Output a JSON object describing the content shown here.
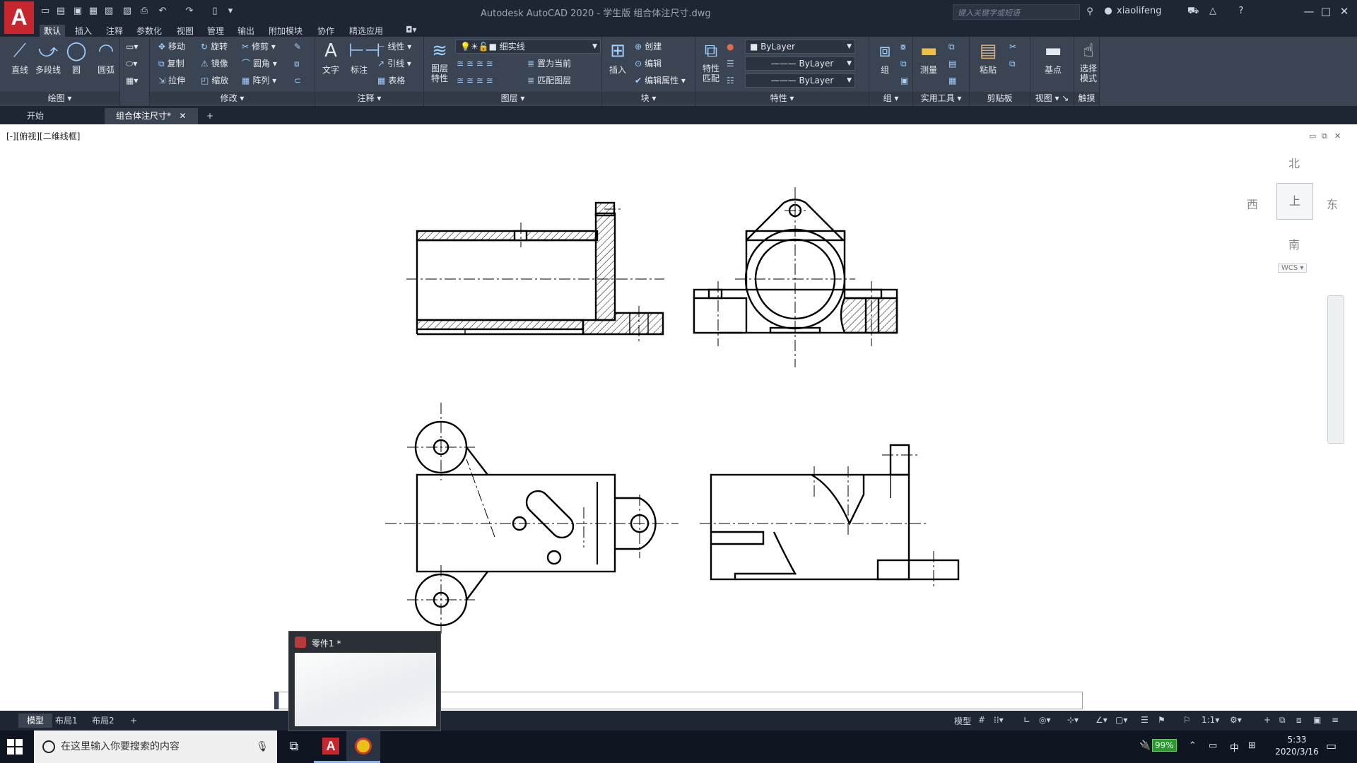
{
  "app": {
    "title": "Autodesk AutoCAD 2020 - 学生版    组合体注尺寸.dwg",
    "search_placeholder": "键入关键字或短语",
    "user": "xiaolifeng"
  },
  "menu": [
    "默认",
    "插入",
    "注释",
    "参数化",
    "视图",
    "管理",
    "输出",
    "附加模块",
    "协作",
    "精选应用"
  ],
  "ribbon": {
    "draw": {
      "title": "绘图",
      "line": "直线",
      "polyline": "多段线",
      "circle": "圆",
      "arc": "圆弧"
    },
    "modify": {
      "title": "修改",
      "move": "移动",
      "rotate": "旋转",
      "trim": "修剪",
      "copy": "复制",
      "mirror": "镜像",
      "fillet": "圆角",
      "stretch": "拉伸",
      "scale": "缩放",
      "array": "阵列"
    },
    "annotation": {
      "title": "注释",
      "text": "文字",
      "dimension": "标注",
      "linear": "线性",
      "leader": "引线",
      "table": "表格"
    },
    "layers": {
      "title": "图层",
      "props": "图层\n特性",
      "layer": "细实线",
      "set_current": "置为当前",
      "match_layer": "匹配图层"
    },
    "block": {
      "title": "块",
      "insert": "插入",
      "create": "创建",
      "edit": "编辑",
      "edit_attr": "编辑属性"
    },
    "properties": {
      "title": "特性",
      "match": "特性\n匹配",
      "color": "ByLayer",
      "linetype": "ByLayer",
      "lineweight": "ByLayer"
    },
    "groups": {
      "title": "组",
      "group": "组"
    },
    "utilities": {
      "title": "实用工具",
      "measure": "测量"
    },
    "clipboard": {
      "title": "剪贴板",
      "paste": "粘贴"
    },
    "view": {
      "title": "视图",
      "base": "基点"
    },
    "touch": {
      "title": "触摸",
      "select_mode": "选择\n模式"
    }
  },
  "doc_tabs": [
    "开始",
    "组合体注尺寸*"
  ],
  "viewport": {
    "label": "[-][俯视][二维线框]",
    "compass": {
      "n": "北",
      "s": "南",
      "e": "东",
      "w": "西"
    },
    "cube_face": "上",
    "wcs": "WCS"
  },
  "layout_tabs": [
    "模型",
    "布局1",
    "布局2"
  ],
  "status": {
    "model": "模型",
    "scale": "1:1"
  },
  "taskbar": {
    "search": "在这里输入你要搜索的内容",
    "battery": "99%",
    "ime": "中",
    "time": "5:33",
    "date": "2020/3/16"
  },
  "preview": {
    "title": "零件1 *"
  }
}
